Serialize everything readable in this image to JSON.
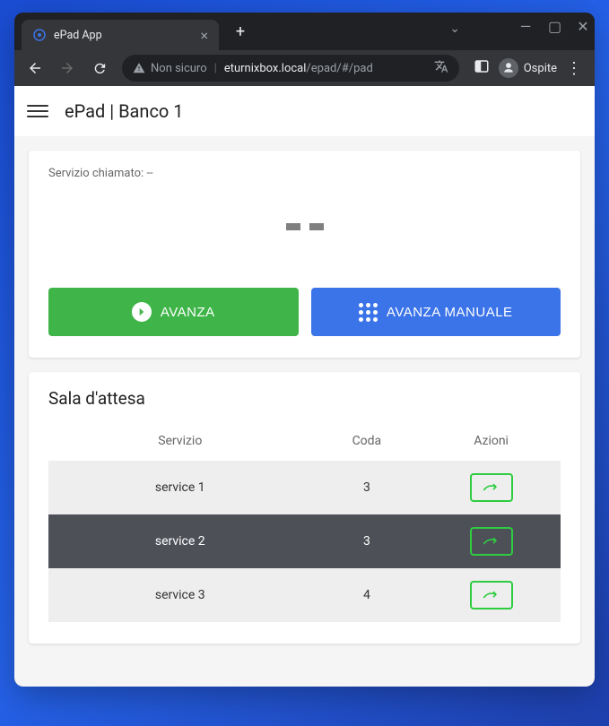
{
  "browser": {
    "tab_title": "ePad App",
    "not_secure_label": "Non sicuro",
    "url_host": "eturnixbox.local",
    "url_path": "/epad/#/pad",
    "guest_label": "Ospite"
  },
  "app": {
    "title": "ePad | Banco 1"
  },
  "main": {
    "service_called_label": "Servizio chiamato:",
    "service_called_value": "--",
    "ticket_dash1": "–",
    "ticket_dash2": "–",
    "advance_label": "AVANZA",
    "advance_manual_label": "AVANZA MANUALE"
  },
  "waiting_room": {
    "title": "Sala d'attesa",
    "columns": {
      "service": "Servizio",
      "queue": "Coda",
      "actions": "Azioni"
    },
    "rows": [
      {
        "service": "service 1",
        "queue": 3,
        "variant": "odd"
      },
      {
        "service": "service 2",
        "queue": 3,
        "variant": "dark"
      },
      {
        "service": "service 3",
        "queue": 4,
        "variant": "odd"
      }
    ]
  }
}
